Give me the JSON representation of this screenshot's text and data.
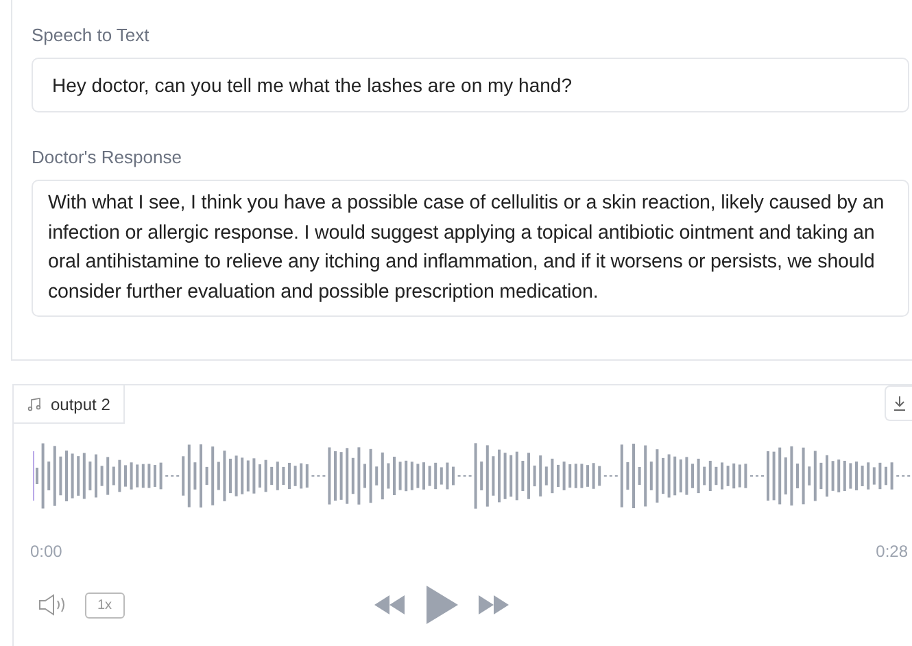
{
  "speech_to_text": {
    "label": "Speech to Text",
    "value": "Hey doctor, can you tell me what the lashes are on my hand?"
  },
  "doctor_response": {
    "label": "Doctor's Response",
    "value": "With what I see, I think you have a possible case of cellulitis or a skin reaction, likely caused by an infection or allergic response. I would suggest applying a topical antibiotic ointment and taking an oral antihistamine to relieve any itching and inflammation, and if it worsens or persists, we should consider further evaluation and possible prescription medication."
  },
  "audio": {
    "label": "output 2",
    "current_time": "0:00",
    "duration": "0:28",
    "speed": "1x"
  }
}
